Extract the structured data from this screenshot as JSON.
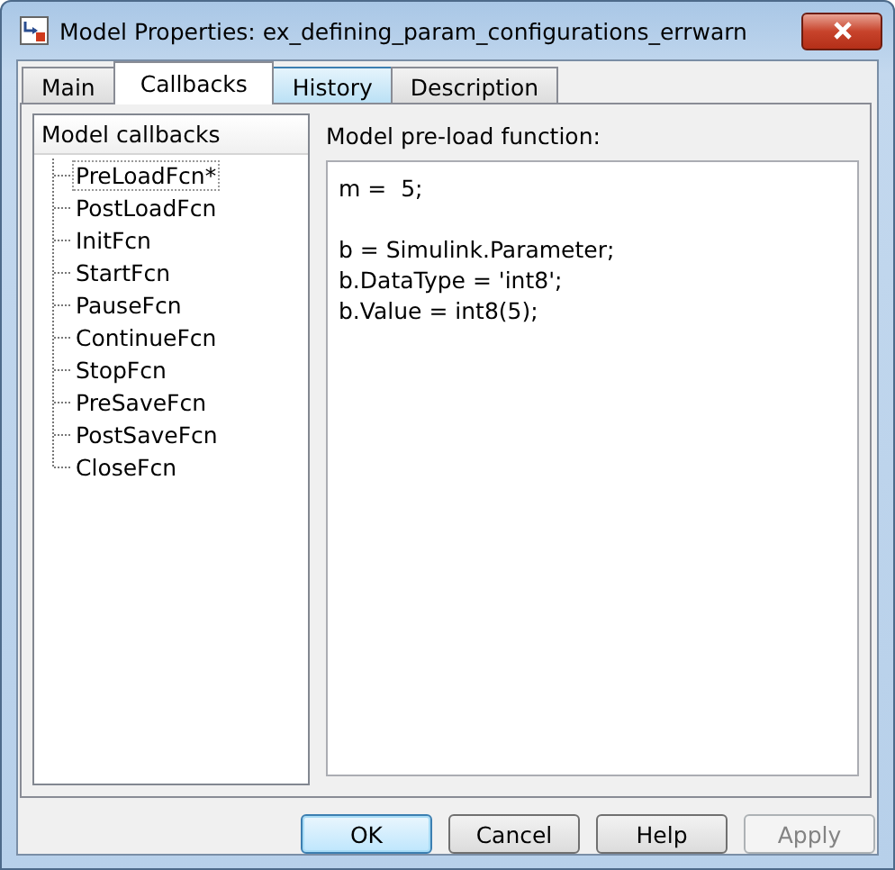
{
  "window": {
    "title": "Model Properties: ex_defining_param_configurations_errwarn"
  },
  "tabs": [
    {
      "label": "Main",
      "selected": false,
      "hovered": false
    },
    {
      "label": "Callbacks",
      "selected": true,
      "hovered": false
    },
    {
      "label": "History",
      "selected": false,
      "hovered": true
    },
    {
      "label": "Description",
      "selected": false,
      "hovered": false
    }
  ],
  "callbacks": {
    "header": "Model callbacks",
    "items": [
      {
        "label": "PreLoadFcn*",
        "selected": true
      },
      {
        "label": "PostLoadFcn",
        "selected": false
      },
      {
        "label": "InitFcn",
        "selected": false
      },
      {
        "label": "StartFcn",
        "selected": false
      },
      {
        "label": "PauseFcn",
        "selected": false
      },
      {
        "label": "ContinueFcn",
        "selected": false
      },
      {
        "label": "StopFcn",
        "selected": false
      },
      {
        "label": "PreSaveFcn",
        "selected": false
      },
      {
        "label": "PostSaveFcn",
        "selected": false
      },
      {
        "label": "CloseFcn",
        "selected": false
      }
    ]
  },
  "editor": {
    "label": "Model pre-load function:",
    "value": "m =  5;\n\nb = Simulink.Parameter;\nb.DataType = 'int8';\nb.Value = int8(5);"
  },
  "buttons": [
    {
      "label": "OK",
      "default": true,
      "disabled": false
    },
    {
      "label": "Cancel",
      "default": false,
      "disabled": false
    },
    {
      "label": "Help",
      "default": false,
      "disabled": false
    },
    {
      "label": "Apply",
      "default": false,
      "disabled": true
    }
  ]
}
